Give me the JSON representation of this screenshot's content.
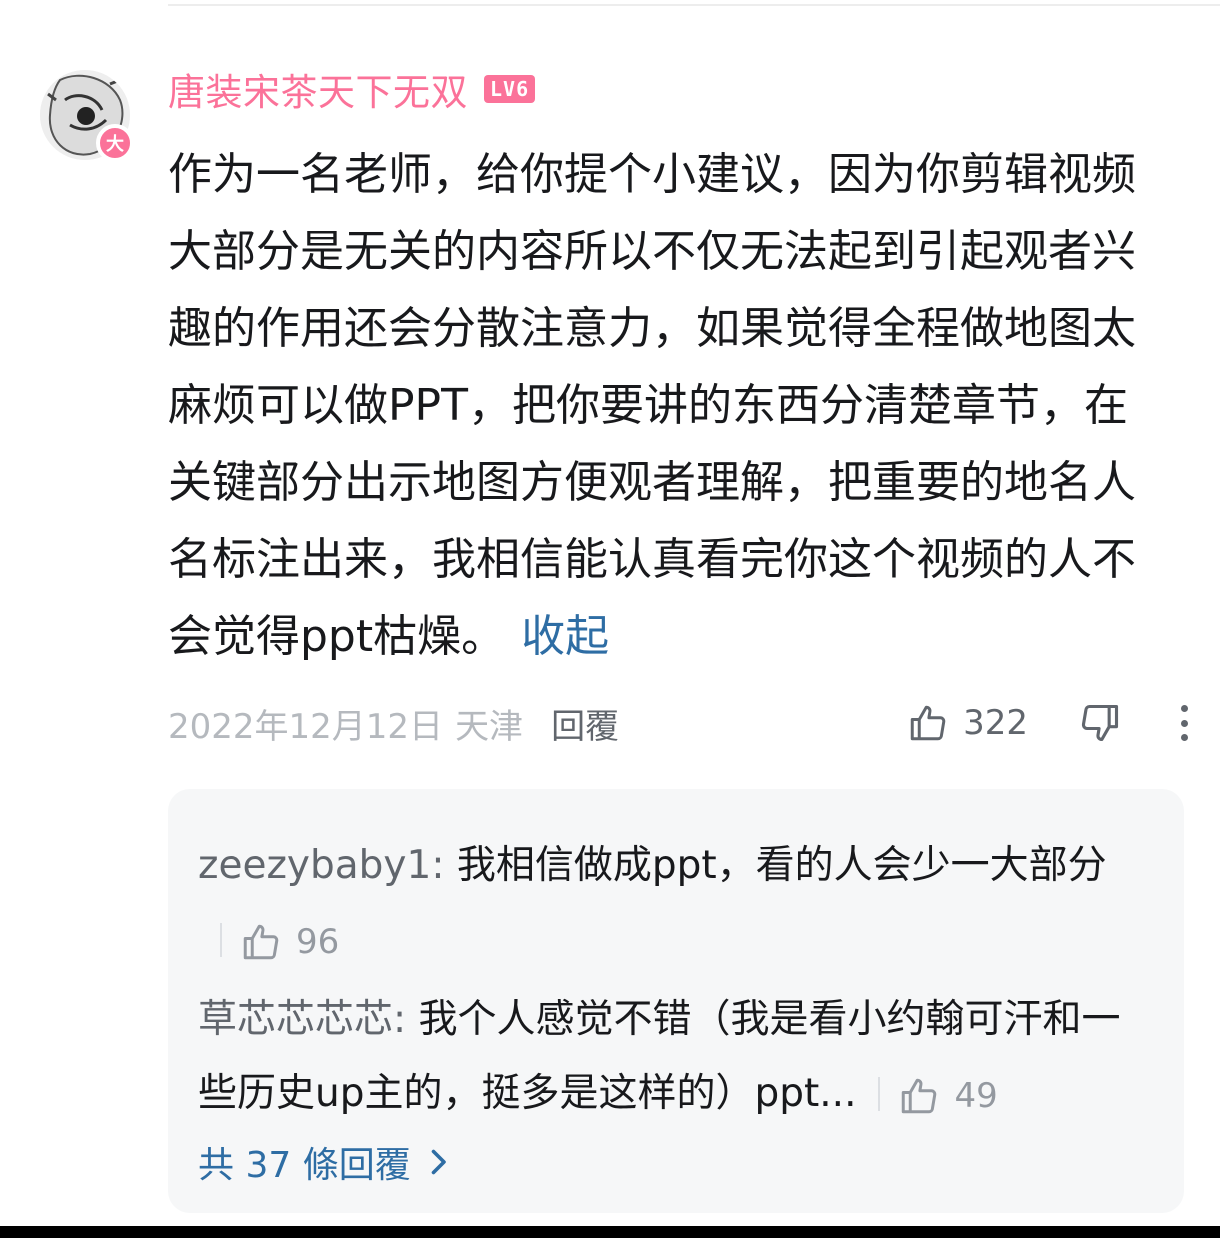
{
  "comment": {
    "username": "唐装宋茶天下无双",
    "level": "LV6",
    "avatar_badge": "大",
    "text": "作为一名老师，给你提个小建议，因为你剪辑视频大部分是无关的内容所以不仅无法起到引起观者兴趣的作用还会分散注意力，如果觉得全程做地图太麻烦可以做PPT，把你要讲的东西分清楚章节，在关键部分出示地图方便观者理解，把重要的地名人名标注出来，我相信能认真看完你这个视频的人不会觉得ppt枯燥。",
    "collapse_label": "收起",
    "date": "2022年12月12日",
    "location": "天津",
    "reply_label": "回覆",
    "like_count": "322"
  },
  "replies": [
    {
      "user": "zeezybaby1:",
      "text": " 我相信做成ppt，看的人会少一大部分",
      "likes": "96"
    },
    {
      "user": "草芯芯芯芯:",
      "text": " 我个人感觉不错（我是看小约翰可汗和一些历史up主的，挺多是这样的）ppt...",
      "likes": "49"
    }
  ],
  "total_replies_label": "共 37 條回覆",
  "colors": {
    "accent_pink": "#fb7299",
    "link_blue": "#2e6da4"
  }
}
